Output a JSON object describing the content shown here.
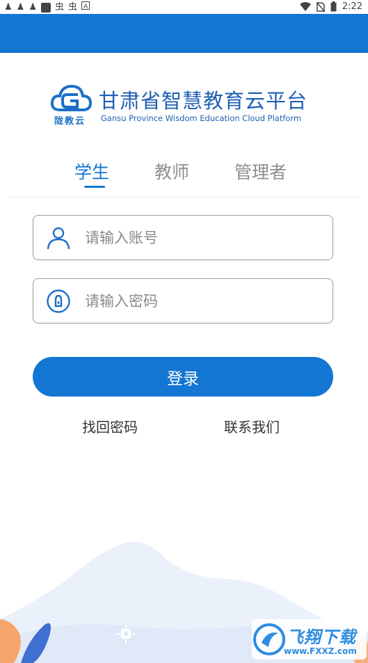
{
  "status_bar": {
    "left_glyphs": [
      "♟",
      "♟",
      "♟"
    ],
    "bug_glyphs": [
      "虫",
      "虫"
    ],
    "time": "2:22"
  },
  "brand": {
    "logo_caption": "陇教云",
    "title_cn": "甘肃省智慧教育云平台",
    "title_en": "Gansu Province Wisdom Education Cloud Platform"
  },
  "tabs": [
    {
      "label": "学生",
      "active": true
    },
    {
      "label": "教师",
      "active": false
    },
    {
      "label": "管理者",
      "active": false
    }
  ],
  "form": {
    "account_placeholder": "请输入账号",
    "password_placeholder": "请输入密码",
    "login_label": "登录"
  },
  "links": {
    "forgot_password": "找回密码",
    "contact_us": "联系我们"
  },
  "watermark": {
    "brand": "飞翔下载",
    "url": "www.FXXZ.com"
  },
  "colors": {
    "primary": "#1476d3",
    "title": "#1f5fb3"
  }
}
